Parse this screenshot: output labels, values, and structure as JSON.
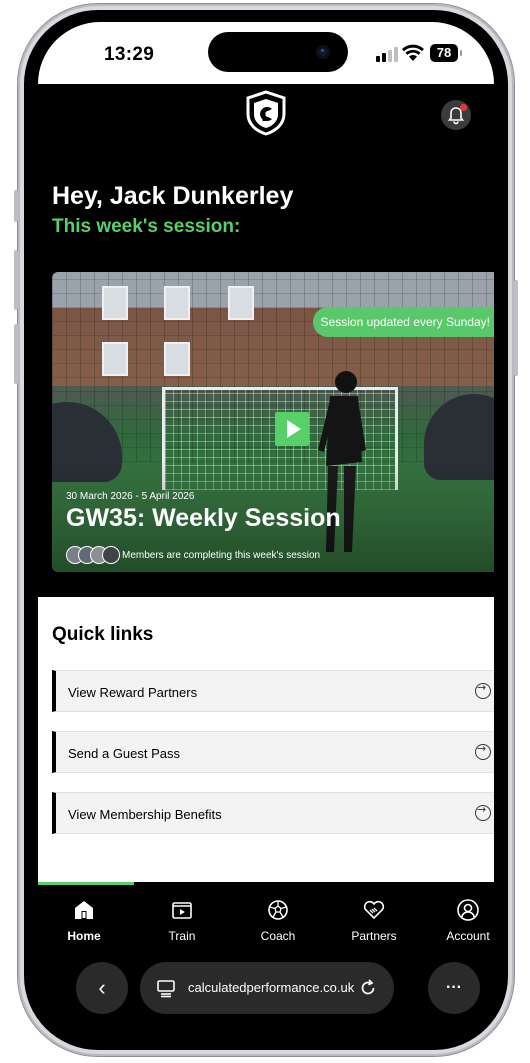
{
  "status": {
    "time": "13:29",
    "battery": "78"
  },
  "header": {
    "logo": "logo-shield-icon",
    "bell": "bell-icon"
  },
  "greeting": {
    "title": "Hey, Jack Dunkerley",
    "subtitle": "This week's session:"
  },
  "session": {
    "badge": "Session updated every Sunday!",
    "dates": "30 March 2026 - 5 April 2026",
    "title": "GW35: Weekly Session",
    "members_text": "Members are completing this week's session"
  },
  "quick_links": {
    "title": "Quick links",
    "items": [
      {
        "label": "View Reward Partners"
      },
      {
        "label": "Send a Guest Pass"
      },
      {
        "label": "View Membership Benefits"
      }
    ]
  },
  "tabs": [
    {
      "label": "Home",
      "icon": "home-icon",
      "active": true
    },
    {
      "label": "Train",
      "icon": "play-screen-icon",
      "active": false
    },
    {
      "label": "Coach",
      "icon": "football-icon",
      "active": false
    },
    {
      "label": "Partners",
      "icon": "handshake-heart-icon",
      "active": false
    },
    {
      "label": "Account",
      "icon": "person-icon",
      "active": false
    }
  ],
  "browser": {
    "url": "calculatedperformance.co.uk",
    "back": "‹",
    "more": "···"
  },
  "colors": {
    "accent": "#58d06a",
    "background": "#000000"
  }
}
